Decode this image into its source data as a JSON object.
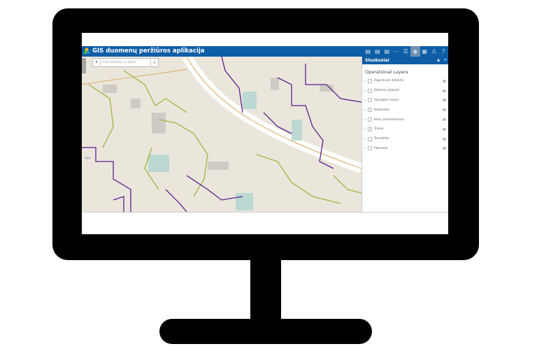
{
  "app": {
    "title": "GIS duomenų peržiūros aplikacija",
    "brand_color": "#0d5ea6"
  },
  "toolbar": {
    "icons": [
      "print-icon",
      "print-icon",
      "print-icon",
      "more-icon",
      "list-icon",
      "layers-icon",
      "grid-icon",
      "warning-icon",
      "help-icon"
    ],
    "active": "layers-icon"
  },
  "search": {
    "placeholder": "Find address or place"
  },
  "map": {
    "scale_label": "5000",
    "pipe_color": "#5a1f8a",
    "line_color": "#9ab83a"
  },
  "panel": {
    "title": "Sluoksniai",
    "section": "Operational Layers",
    "layers": [
      {
        "label": "Registruoti defektai",
        "checked": false
      },
      {
        "label": "Elektros_kabeliai",
        "checked": false
      },
      {
        "label": "Atjungtos trasos",
        "checked": false
      },
      {
        "label": "Bekanaliai",
        "checked": true
      },
      {
        "label": "Kitos_komunikacijos",
        "checked": false
      },
      {
        "label": "Trasos",
        "checked": true
      },
      {
        "label": "Termofoto",
        "checked": false
      },
      {
        "label": "Plansetai",
        "checked": false
      }
    ]
  }
}
